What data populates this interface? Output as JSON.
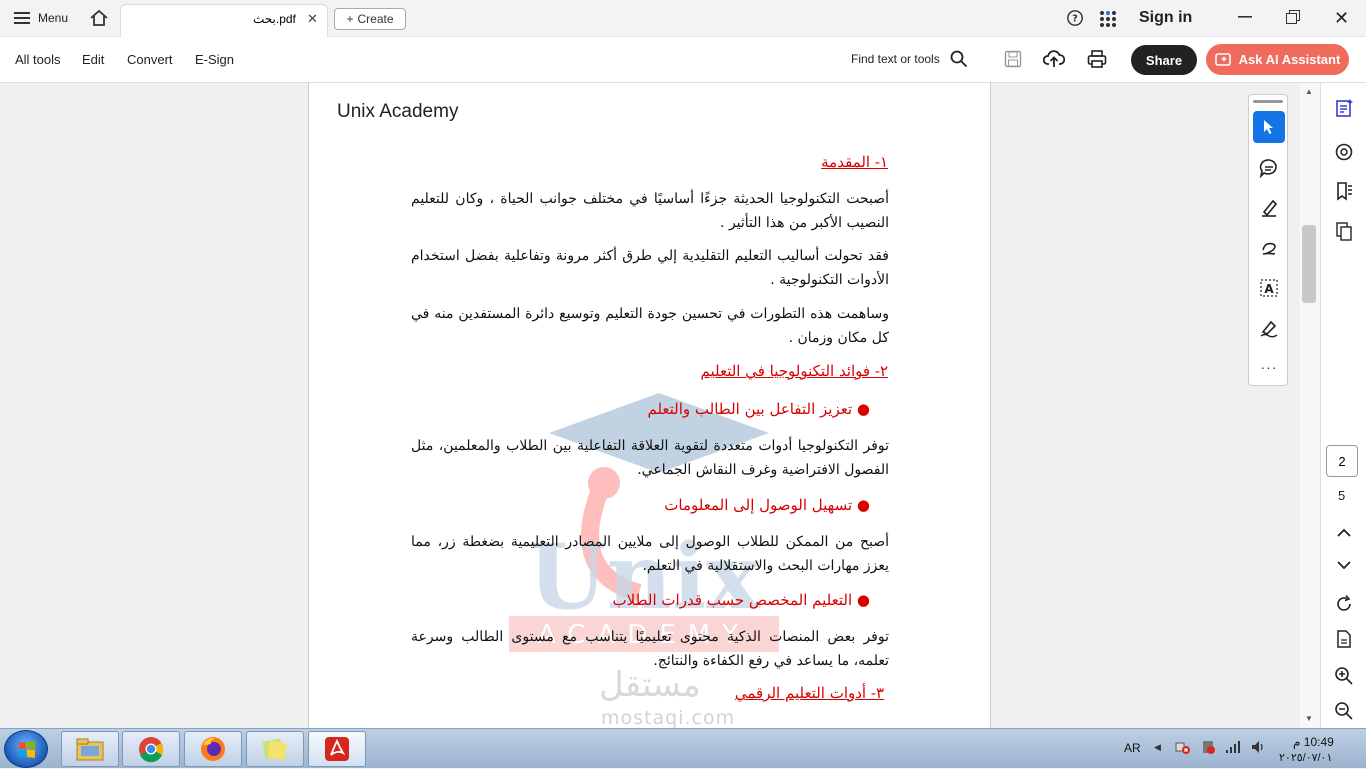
{
  "titlebar": {
    "menu_label": "Menu",
    "tab_title": "بحث.pdf",
    "create_label": "Create",
    "sign_in": "Sign in"
  },
  "toolbar": {
    "all_tools": "All tools",
    "edit": "Edit",
    "convert": "Convert",
    "esign": "E-Sign",
    "find": "Find text or tools",
    "share": "Share",
    "ai": "Ask AI Assistant"
  },
  "document": {
    "header": "Unix Academy",
    "h1": "١- المقدمة",
    "p1": "أصبحت التكنولوجيا الحديثة جزءًا أساسيًا في مختلف جوانب الحياة ، وكان للتعليم النصيب الأكبر من هذا التأثير .",
    "p2": "فقد تحولت أساليب التعليم التقليدية إلي طرق أكثر مرونة وتفاعلية بفضل استخدام الأدوات التكنولوجية .",
    "p3": "وساهمت هذه التطورات في تحسين جودة التعليم وتوسيع دائرة المستفدين منه في كل مكان وزمان .",
    "h2": "٢- فوائد التكنولوجيا في التعليم",
    "b1": "تعزيز التفاعل بين الطالب والتعلم",
    "p4": "توفر التكنولوجيا أدوات متعددة لتقوية العلاقة التفاعلية بين الطلاب والمعلمين، مثل الفصول الافتراضية وغرف النقاش الجماعي.",
    "b2": "تسهيل الوصول إلى المعلومات",
    "p5": "أصبح من الممكن للطلاب الوصول إلى ملايين المصادر التعليمية بضغطة زر، مما يعزز مهارات البحث والاستقلالية في التعلم.",
    "b3": "التعليم المخصص حسب قدرات الطلاب",
    "p6": "توفر بعض المنصات الذكية محتوى تعليميًا يتناسب مع مستوى الطالب وسرعة تعلمه، ما يساعد في رفع الكفاءة والنتائج.",
    "h3": "٣- أدوات التعليم الرقمي",
    "watermark_word": "Unix",
    "watermark_sub": "ACADEMY",
    "watermark_site": "mostaqi.com",
    "watermark_ar": "مستقل"
  },
  "pager": {
    "current": "2",
    "total": "5"
  },
  "tray": {
    "lang": "AR",
    "time": "10:49 م",
    "date": "٢٠٢٥/٠٧/٠١"
  },
  "colors": {
    "accent_red": "#d90000",
    "ai_button": "#f06b5c",
    "select_tool": "#1473e6"
  }
}
